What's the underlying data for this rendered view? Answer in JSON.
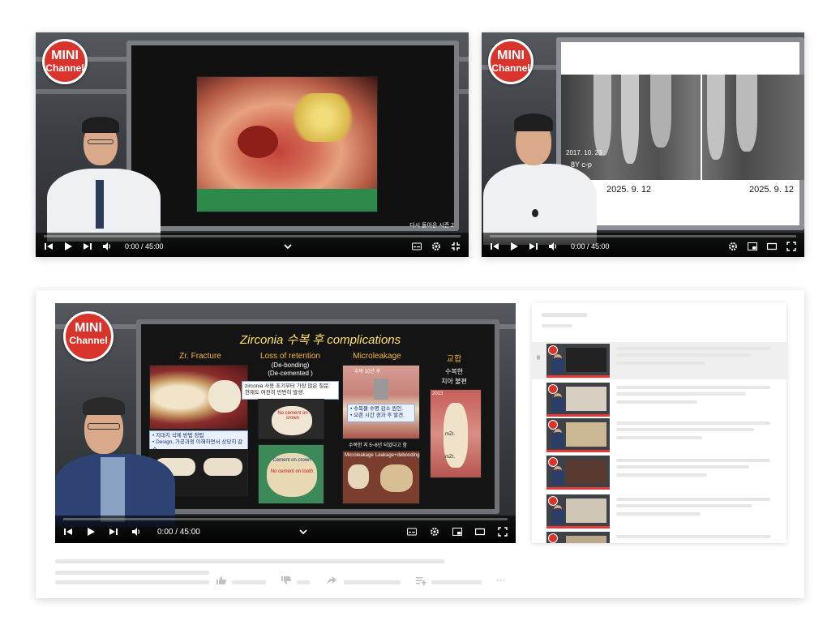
{
  "players": [
    {
      "id": "top-left",
      "logo": {
        "line1": "MINI",
        "line2": "Channel"
      },
      "overlay_text": "다시 돌아온 시즌 2",
      "time": "0:00 / 45:00"
    },
    {
      "id": "top-right",
      "logo": {
        "line1": "MINI",
        "line2": "Channel"
      },
      "xray_labels": {
        "date_old": "2017. 10. 23",
        "code": "8Y c-p",
        "date_left": "2025. 9. 12",
        "date_right": "2025. 9. 12"
      },
      "time": "0:00 / 45:00"
    },
    {
      "id": "main",
      "logo": {
        "line1": "MINI",
        "line2": "Channel"
      },
      "time": "0:00 / 45:00",
      "slide": {
        "title": "Zirconia 수복 후 complications",
        "col1": {
          "title": "Zr. Fracture",
          "note_lines": [
            "• 지대치 삭제 방법 정립",
            "• Design, 가공과정 이해하면서 상당히 감소"
          ]
        },
        "col2": {
          "title": "Loss of retention",
          "sub1": "(De-bonding)",
          "sub2": "(De-cemented )",
          "note_lines": [
            "zirconia 사용 초기부터 가장 많은 질문.",
            "현재도 여전히 빈번히 발생."
          ],
          "tag1": "No cement on crown",
          "tag2a": "Cement on crown",
          "tag2b": "No cement on tooth"
        },
        "col3": {
          "title": "Microleakage",
          "top_tag": "수복 10년 후",
          "note_lines": [
            "• 수복물 수명 감소 원인.",
            "• 오랜 시간 경과 후 발견."
          ],
          "mid_tag": "수복한 지 5~6년 되었다고 함",
          "bottom_left": "Microleakage",
          "bottom_right": "Leakage+debonding"
        },
        "col4": {
          "title": "교합",
          "sub1": "수복한",
          "sub2": "치아 불편",
          "year": "2013",
          "tag1": "mZr.",
          "tag2": "mZr."
        }
      }
    }
  ],
  "colors": {
    "accent": "#ff0000",
    "logo": "#d9342b",
    "slide_title": "#ffe26a",
    "col_title": "#f4b641"
  },
  "icons": [
    "prev-icon",
    "play-icon",
    "next-icon",
    "volume-icon",
    "chevron-down-icon",
    "subtitles-icon",
    "settings-icon",
    "miniplayer-icon",
    "theater-icon",
    "fullscreen-icon",
    "like-icon",
    "dislike-icon",
    "share-icon",
    "save-icon",
    "more-icon"
  ],
  "actions": {
    "more": "..."
  }
}
